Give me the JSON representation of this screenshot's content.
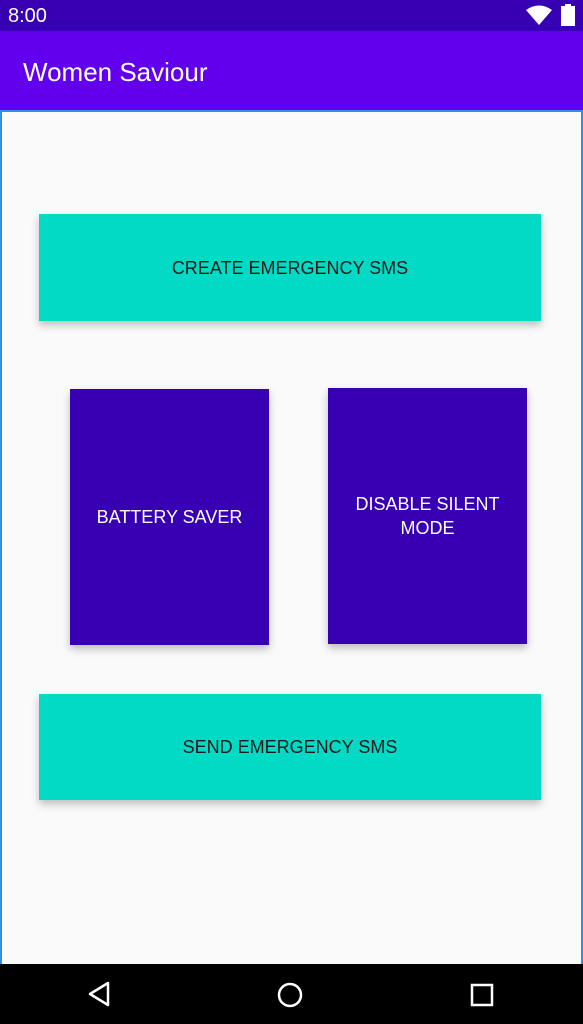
{
  "status_bar": {
    "time": "8:00",
    "icons": [
      "wifi-icon",
      "battery-icon"
    ]
  },
  "app_bar": {
    "title": "Women Saviour"
  },
  "buttons": {
    "create_sms": "CREATE EMERGENCY SMS",
    "battery_saver": "BATTERY SAVER",
    "disable_silent": "DISABLE SILENT MODE",
    "send_sms": "SEND EMERGENCY SMS"
  },
  "nav_bar": {
    "icons": [
      "back-icon",
      "home-icon",
      "recents-icon"
    ]
  },
  "colors": {
    "status_bar": "#3700b3",
    "app_bar": "#6200ee",
    "teal_button": "#03dac5",
    "purple_button": "#3700b3"
  }
}
